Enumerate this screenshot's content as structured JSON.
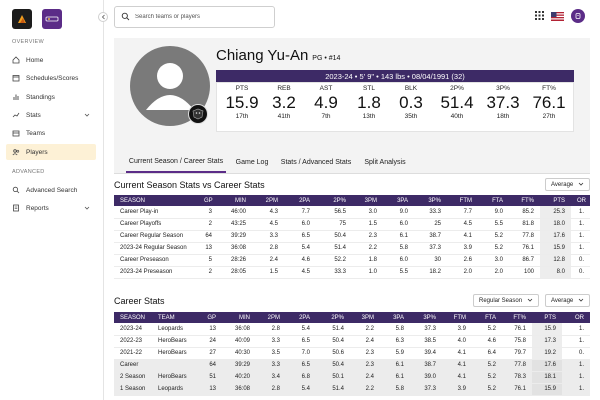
{
  "sidebar": {
    "overview_label": "OVERVIEW",
    "advanced_label": "ADVANCED",
    "items": [
      {
        "label": "Home"
      },
      {
        "label": "Schedules/Scores"
      },
      {
        "label": "Standings"
      },
      {
        "label": "Stats"
      },
      {
        "label": "Teams"
      },
      {
        "label": "Players"
      },
      {
        "label": "Advanced Search"
      },
      {
        "label": "Reports"
      }
    ]
  },
  "search": {
    "placeholder": "Search teams or players"
  },
  "player": {
    "name": "Chiang Yu-An",
    "position": "PG • #14",
    "info": "2023-24 • 5' 9\" • 143 lbs • 08/04/1991 (32)",
    "stats": [
      {
        "label": "PTS",
        "value": "15.9",
        "rank": "17th"
      },
      {
        "label": "REB",
        "value": "3.2",
        "rank": "41th"
      },
      {
        "label": "AST",
        "value": "4.9",
        "rank": "7th"
      },
      {
        "label": "STL",
        "value": "1.8",
        "rank": "13th"
      },
      {
        "label": "BLK",
        "value": "0.3",
        "rank": "35th"
      },
      {
        "label": "2P%",
        "value": "51.4",
        "rank": "40th"
      },
      {
        "label": "3P%",
        "value": "37.3",
        "rank": "18th"
      },
      {
        "label": "FT%",
        "value": "76.1",
        "rank": "27th"
      }
    ]
  },
  "tabs": [
    "Current Season / Career Stats",
    "Game Log",
    "Stats / Advanced Stats",
    "Split Analysis"
  ],
  "current_section": {
    "title": "Current Season Stats vs Career Stats",
    "dropdown": "Average",
    "headers": [
      "SEASON",
      "GP",
      "MIN",
      "2PM",
      "2PA",
      "2P%",
      "3PM",
      "3PA",
      "3P%",
      "FTM",
      "FTA",
      "FT%",
      "PTS",
      "OR"
    ],
    "rows": [
      [
        "Career Play-in",
        "3",
        "46:00",
        "4.3",
        "7.7",
        "56.5",
        "3.0",
        "9.0",
        "33.3",
        "7.7",
        "9.0",
        "85.2",
        "25.3",
        "1."
      ],
      [
        "Career Playoffs",
        "2",
        "43:25",
        "4.5",
        "6.0",
        "75",
        "1.5",
        "6.0",
        "25",
        "4.5",
        "5.5",
        "81.8",
        "18.0",
        "1."
      ],
      [
        "Career Regular Season",
        "64",
        "39:29",
        "3.3",
        "6.5",
        "50.4",
        "2.3",
        "6.1",
        "38.7",
        "4.1",
        "5.2",
        "77.8",
        "17.6",
        "1."
      ],
      [
        "2023-24 Regular Season",
        "13",
        "36:08",
        "2.8",
        "5.4",
        "51.4",
        "2.2",
        "5.8",
        "37.3",
        "3.9",
        "5.2",
        "76.1",
        "15.9",
        "1."
      ],
      [
        "Career Preseason",
        "5",
        "28:26",
        "2.4",
        "4.6",
        "52.2",
        "1.8",
        "6.0",
        "30",
        "2.6",
        "3.0",
        "86.7",
        "12.8",
        "0."
      ],
      [
        "2023-24 Preseason",
        "2",
        "28:05",
        "1.5",
        "4.5",
        "33.3",
        "1.0",
        "5.5",
        "18.2",
        "2.0",
        "2.0",
        "100",
        "8.0",
        "0."
      ]
    ]
  },
  "career_section": {
    "title": "Career Stats",
    "dropdown_type": "Regular Season",
    "dropdown_mode": "Average",
    "headers": [
      "SEASON",
      "TEAM",
      "GP",
      "MIN",
      "2PM",
      "2PA",
      "2P%",
      "3PM",
      "3PA",
      "3P%",
      "FTM",
      "FTA",
      "FT%",
      "PTS",
      "OR"
    ],
    "rows": [
      [
        "2023-24",
        "Leopards",
        "13",
        "36:08",
        "2.8",
        "5.4",
        "51.4",
        "2.2",
        "5.8",
        "37.3",
        "3.9",
        "5.2",
        "76.1",
        "15.9",
        "1."
      ],
      [
        "2022-23",
        "HeroBears",
        "24",
        "40:09",
        "3.3",
        "6.5",
        "50.4",
        "2.4",
        "6.3",
        "38.5",
        "4.0",
        "4.6",
        "75.8",
        "17.3",
        "1."
      ],
      [
        "2021-22",
        "HeroBears",
        "27",
        "40:30",
        "3.5",
        "7.0",
        "50.6",
        "2.3",
        "5.9",
        "39.4",
        "4.1",
        "6.4",
        "79.7",
        "19.2",
        "0."
      ],
      [
        "Career",
        "",
        "64",
        "39:29",
        "3.3",
        "6.5",
        "50.4",
        "2.3",
        "6.1",
        "38.7",
        "4.1",
        "5.2",
        "77.8",
        "17.6",
        "1."
      ],
      [
        "2 Season",
        "HeroBears",
        "51",
        "40:20",
        "3.4",
        "6.8",
        "50.1",
        "2.4",
        "6.1",
        "39.0",
        "4.1",
        "5.2",
        "78.3",
        "18.1",
        "1."
      ],
      [
        "1 Season",
        "Leopards",
        "13",
        "36:08",
        "2.8",
        "5.4",
        "51.4",
        "2.2",
        "5.8",
        "37.3",
        "3.9",
        "5.2",
        "76.1",
        "15.9",
        "1."
      ]
    ]
  }
}
